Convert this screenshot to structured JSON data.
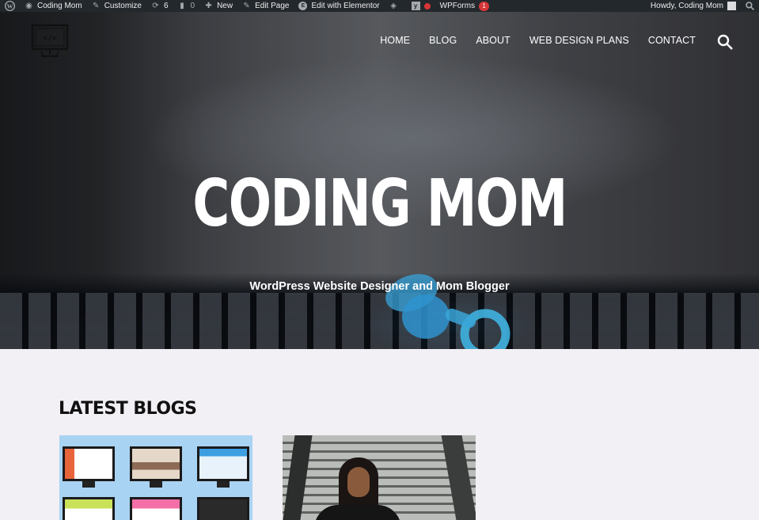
{
  "adminbar": {
    "wp_logo": "wordpress-icon",
    "site_name": "Coding Mom",
    "customize": "Customize",
    "updates_count": "6",
    "comments_count": "0",
    "new_label": "New",
    "edit_page": "Edit Page",
    "edit_elementor": "Edit with Elementor",
    "wpforms": "WPForms",
    "wpforms_count": "1",
    "howdy": "Howdy, Coding Mom"
  },
  "header": {
    "nav": [
      "HOME",
      "BLOG",
      "ABOUT",
      "WEB DESIGN PLANS",
      "CONTACT"
    ]
  },
  "hero": {
    "title": "CODING MOM",
    "subtitle": "WordPress Website Designer and Mom Blogger"
  },
  "blogs": {
    "title": "LATEST BLOGS"
  },
  "colors": {
    "adminbar_bg": "#23282d",
    "badge": "#d63638",
    "page_bg": "#f2f0f4"
  }
}
